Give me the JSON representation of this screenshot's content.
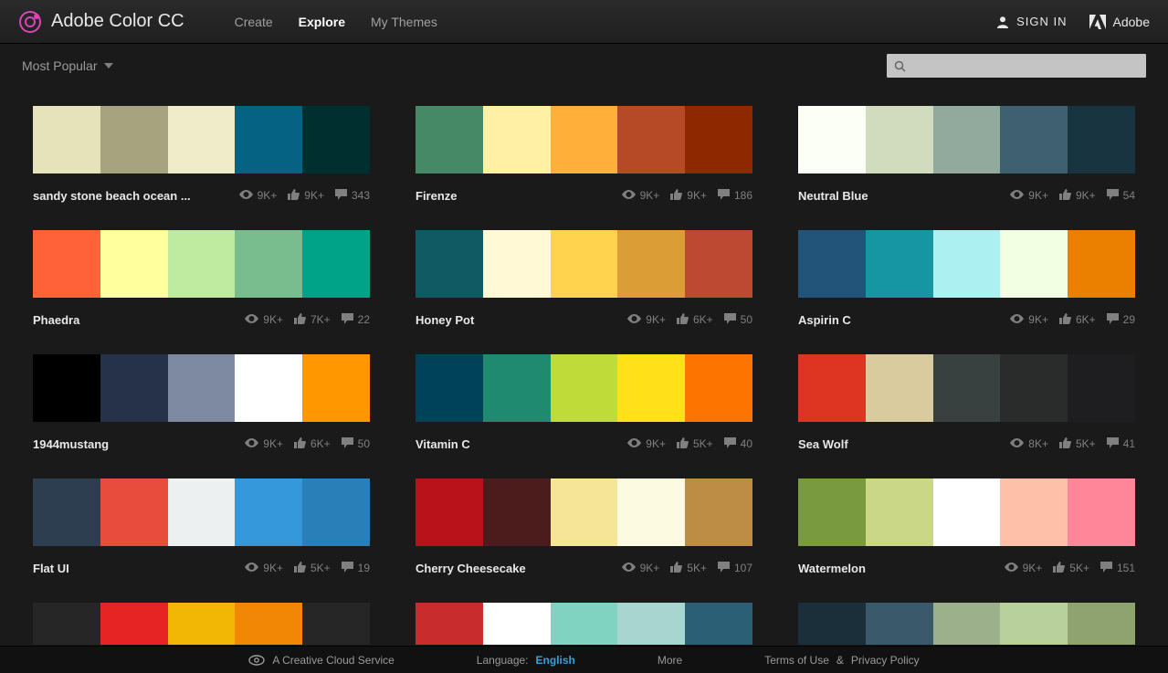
{
  "app": {
    "title": "Adobe Color CC"
  },
  "nav": {
    "create": "Create",
    "explore": "Explore",
    "mythemes": "My Themes"
  },
  "auth": {
    "signin": "SIGN IN",
    "adobe": "Adobe"
  },
  "sort": {
    "label": "Most Popular"
  },
  "search": {
    "value": ""
  },
  "palettes": [
    {
      "name": "sandy stone beach ocean ...",
      "colors": [
        "#e6e2b9",
        "#a7a37e",
        "#efecca",
        "#046380",
        "#002f2f"
      ],
      "views": "9K+",
      "likes": "9K+",
      "comments": "343"
    },
    {
      "name": "Firenze",
      "colors": [
        "#468966",
        "#fff0a5",
        "#ffb03b",
        "#b64926",
        "#8e2800"
      ],
      "views": "9K+",
      "likes": "9K+",
      "comments": "186"
    },
    {
      "name": "Neutral Blue",
      "colors": [
        "#fcfff5",
        "#d1dbbd",
        "#91aa9d",
        "#3e606f",
        "#193441"
      ],
      "views": "9K+",
      "likes": "9K+",
      "comments": "54"
    },
    {
      "name": "Phaedra",
      "colors": [
        "#ff6138",
        "#ffff9d",
        "#beeb9f",
        "#79bd8f",
        "#00a388"
      ],
      "views": "9K+",
      "likes": "7K+",
      "comments": "22"
    },
    {
      "name": "Honey Pot",
      "colors": [
        "#105b63",
        "#fffad5",
        "#ffd34e",
        "#db9e36",
        "#bd4932"
      ],
      "views": "9K+",
      "likes": "6K+",
      "comments": "50"
    },
    {
      "name": "Aspirin C",
      "colors": [
        "#225378",
        "#1695a3",
        "#acf0f2",
        "#f3ffe2",
        "#eb7f00"
      ],
      "views": "9K+",
      "likes": "6K+",
      "comments": "29"
    },
    {
      "name": "1944mustang",
      "colors": [
        "#000000",
        "#263248",
        "#7e8aa2",
        "#ffffff",
        "#ff9800"
      ],
      "views": "9K+",
      "likes": "6K+",
      "comments": "50"
    },
    {
      "name": "Vitamin C",
      "colors": [
        "#004358",
        "#1f8a70",
        "#bedb39",
        "#ffe11a",
        "#fd7400"
      ],
      "views": "9K+",
      "likes": "5K+",
      "comments": "40"
    },
    {
      "name": "Sea Wolf",
      "colors": [
        "#dc3522",
        "#d9cb9e",
        "#374140",
        "#2a2c2b",
        "#1e1e20"
      ],
      "views": "8K+",
      "likes": "5K+",
      "comments": "41"
    },
    {
      "name": "Flat UI",
      "colors": [
        "#2c3e50",
        "#e74c3c",
        "#ecf0f1",
        "#3498db",
        "#2980b9"
      ],
      "views": "9K+",
      "likes": "5K+",
      "comments": "19"
    },
    {
      "name": "Cherry Cheesecake",
      "colors": [
        "#b9121b",
        "#4c1b1b",
        "#f6e497",
        "#fcfae1",
        "#bd8d46"
      ],
      "views": "9K+",
      "likes": "5K+",
      "comments": "107"
    },
    {
      "name": "Watermelon",
      "colors": [
        "#7a9b3d",
        "#c9d787",
        "#ffffff",
        "#ffc0a9",
        "#ff8598"
      ],
      "views": "9K+",
      "likes": "5K+",
      "comments": "151"
    },
    {
      "name": "",
      "colors": [
        "#262626",
        "#e62424",
        "#f2b705",
        "#f28705",
        "#262626"
      ],
      "views": "",
      "likes": "",
      "comments": ""
    },
    {
      "name": "",
      "colors": [
        "#c92c2c",
        "#ffffff",
        "#7fd4c1",
        "#a6d6cf",
        "#2b5f75"
      ],
      "views": "",
      "likes": "",
      "comments": ""
    },
    {
      "name": "",
      "colors": [
        "#1b2f3a",
        "#3a5a6b",
        "#9cb08b",
        "#b8d19a",
        "#8fa36e"
      ],
      "views": "",
      "likes": "",
      "comments": ""
    }
  ],
  "footer": {
    "cc": "A Creative Cloud Service",
    "lang_label": "Language:",
    "lang_value": "English",
    "more": "More",
    "terms": "Terms of Use",
    "amp": "&",
    "privacy": "Privacy Policy"
  }
}
